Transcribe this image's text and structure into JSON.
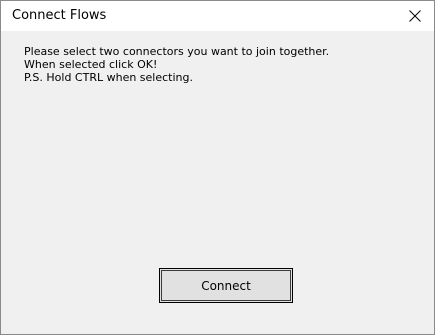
{
  "window": {
    "title": "Connect Flows",
    "close_icon": "close-icon"
  },
  "message": {
    "lines": [
      "Please select two connectors you want to join together.",
      "When selected click OK!",
      "P.S. Hold CTRL when selecting."
    ]
  },
  "buttons": {
    "connect_label": "Connect"
  },
  "colors": {
    "titlebar_bg": "#ffffff",
    "client_bg": "#f0f0f0",
    "button_bg": "#e1e1e1",
    "window_border": "#8a8a8a"
  }
}
